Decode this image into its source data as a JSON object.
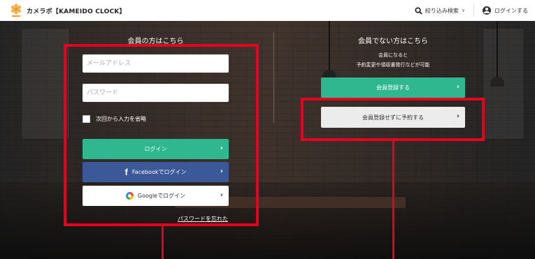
{
  "header": {
    "brand": "カメラボ【KAMEIDO CLOCK】",
    "logo_icon": "flower-logo-icon",
    "search_label": "絞り込み検索",
    "login_label": "ログインする"
  },
  "member": {
    "title": "会員の方はこちら",
    "email_placeholder": "メールアドレス",
    "password_placeholder": "パスワード",
    "remember_label": "次回から入力を省略",
    "login_button": "ログイン",
    "facebook_button": "Facebookでログイン",
    "google_button": "Googleでログイン",
    "forgot_link": "パスワードを忘れた"
  },
  "nonmember": {
    "title": "会員でない方はこちら",
    "sub1": "会員になると",
    "sub2": "予約変更や領収書発行などが可能",
    "register_button": "会員登録する",
    "guest_button": "会員登録せずに予約する"
  },
  "colors": {
    "accent_green": "#2fb890",
    "facebook_blue": "#3b5998",
    "annotation_red": "#e6001e"
  }
}
